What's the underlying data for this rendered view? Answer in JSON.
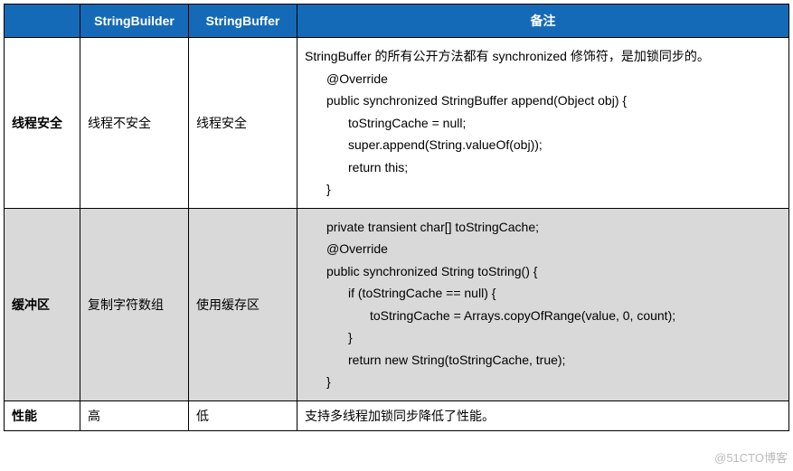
{
  "headers": {
    "col1": "",
    "col2": "StringBuilder",
    "col3": "StringBuffer",
    "col4": "备注"
  },
  "rows": [
    {
      "label": "线程安全",
      "builder": "线程不安全",
      "buffer": "线程安全",
      "note_intro": "StringBuffer 的所有公开方法都有 synchronized 修饰符，是加锁同步的。",
      "note_code": {
        "l1": "@Override",
        "l2": "public synchronized StringBuffer append(Object obj) {",
        "l3": "toStringCache = null;",
        "l4": "super.append(String.valueOf(obj));",
        "l5": "return this;",
        "l6": "}"
      },
      "alt": false
    },
    {
      "label": "缓冲区",
      "builder": "复制字符数组",
      "buffer": "使用缓存区",
      "note_code": {
        "l1": "private transient char[] toStringCache;",
        "l2": "",
        "l3": "@Override",
        "l4": "public synchronized String toString() {",
        "l5": "if (toStringCache == null) {",
        "l6": "toStringCache = Arrays.copyOfRange(value, 0, count);",
        "l7": "}",
        "l8": "return new String(toStringCache, true);",
        "l9": "}"
      },
      "alt": true
    },
    {
      "label": "性能",
      "builder": "高",
      "buffer": "低",
      "note_text": "支持多线程加锁同步降低了性能。",
      "alt": false
    }
  ],
  "watermark": "@51CTO博客"
}
